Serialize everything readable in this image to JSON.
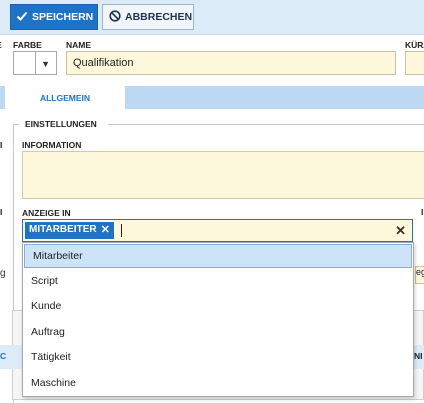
{
  "toolbar": {
    "save_label": "SPEICHERN",
    "cancel_label": "ABBRECHEN"
  },
  "fields": {
    "farbe_label": "FARBE",
    "name_label": "NAME",
    "name_value": "Qualifikation",
    "kurz_label": "KÜRZ"
  },
  "tabs": [
    {
      "label": "ALLGEMEIN",
      "active": true
    }
  ],
  "section": {
    "legend": "EINSTELLUNGEN",
    "information_label": "INFORMATION",
    "anzeige_label": "ANZEIGE IN"
  },
  "multiselect": {
    "chips": [
      {
        "label": "MITARBEITER"
      }
    ],
    "options": [
      {
        "label": "Mitarbeiter",
        "selected": true
      },
      {
        "label": "Script",
        "selected": false
      },
      {
        "label": "Kunde",
        "selected": false
      },
      {
        "label": "Auftrag",
        "selected": false
      },
      {
        "label": "Tätigkeit",
        "selected": false
      },
      {
        "label": "Maschine",
        "selected": false
      }
    ]
  },
  "background": {
    "left_char": "g",
    "right_char": "eg",
    "right_label": "NI",
    "left_edge_label": "C",
    "r_label": "I",
    "z_label": "e"
  },
  "colors": {
    "accent": "#1f73c7",
    "toolbar_bg": "#dcebf8",
    "tabbar_bg": "#bcd8f2",
    "field_bg": "#fdf8dc",
    "selected_option_bg": "#cde3f7"
  }
}
